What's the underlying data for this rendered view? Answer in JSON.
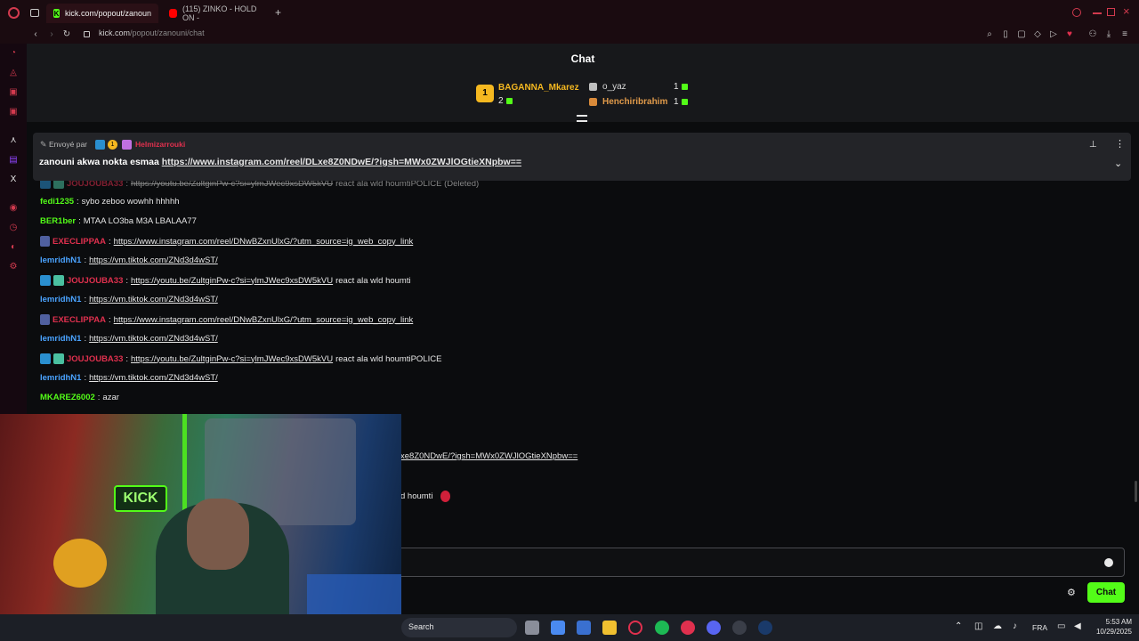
{
  "browser": {
    "tabs": [
      {
        "label": "kick.com/popout/zanoun"
      },
      {
        "label": "(115) ZINKO - HOLD ON -"
      }
    ],
    "url_host": "kick.com",
    "url_path": "/popout/zanouni/chat"
  },
  "chat": {
    "title": "Chat",
    "leaderboard": [
      {
        "rank": "1",
        "name": "BAGANNA_Mkarez",
        "count": "2"
      },
      {
        "rank": "2",
        "name": "o_yaz",
        "count": "1"
      },
      {
        "rank": "3",
        "name": "Henchiribrahim",
        "count": "1"
      }
    ],
    "pinned": {
      "sent_by": "Envoyé par",
      "badge_num": "1",
      "sender": "Helmizarrouki",
      "text": "zanouni akwa nokta esmaa",
      "link": "https://www.instagram.com/reel/DLxe8Z0NDwE/?igsh=MWx0ZWJlOGtieXNpbw=="
    },
    "messages": [
      {
        "user": "JOUJOUBA33",
        "color": "#e0304e",
        "text": "",
        "link": "https://youtu.be/ZultginPw-c?si=ylmJWec9xsDW5kVU",
        "after": "react ala wld houmtiPOLICE (Deleted)",
        "deleted": true
      },
      {
        "user": "fedi1235",
        "color": "#53fc18",
        "text": "sybo zeboo wowhh hhhhh",
        "link": "",
        "after": ""
      },
      {
        "user": "BER1ber",
        "color": "#53fc18",
        "text": "MTAA LO3ba M3A LBALAA77",
        "link": "",
        "after": ""
      },
      {
        "user": "EXECLIPPAA",
        "color": "#e0304e",
        "text": "",
        "link": "https://www.instagram.com/reel/DNwBZxnUlxG/?utm_source=ig_web_copy_link",
        "after": ""
      },
      {
        "user": "lemridhN1",
        "color": "#4aa3ff",
        "text": "",
        "link": "https://vm.tiktok.com/ZNd3d4wST/",
        "after": ""
      },
      {
        "user": "JOUJOUBA33",
        "color": "#e0304e",
        "text": "",
        "link": "https://youtu.be/ZultginPw-c?si=ylmJWec9xsDW5kVU",
        "after": "react ala wld houmti"
      },
      {
        "user": "lemridhN1",
        "color": "#4aa3ff",
        "text": "",
        "link": "https://vm.tiktok.com/ZNd3d4wST/",
        "after": ""
      },
      {
        "user": "EXECLIPPAA",
        "color": "#e0304e",
        "text": "",
        "link": "https://www.instagram.com/reel/DNwBZxnUlxG/?utm_source=ig_web_copy_link",
        "after": ""
      },
      {
        "user": "lemridhN1",
        "color": "#4aa3ff",
        "text": "",
        "link": "https://vm.tiktok.com/ZNd3d4wST/",
        "after": ""
      },
      {
        "user": "JOUJOUBA33",
        "color": "#e0304e",
        "text": "",
        "link": "https://youtu.be/ZultginPw-c?si=ylmJWec9xsDW5kVU",
        "after": "react ala wld houmtiPOLICE"
      },
      {
        "user": "lemridhN1",
        "color": "#4aa3ff",
        "text": "",
        "link": "https://vm.tiktok.com/ZNd3d4wST/",
        "after": ""
      },
      {
        "user": "MKAREZ6002",
        "color": "#53fc18",
        "text": "azar",
        "link": "",
        "after": ""
      }
    ],
    "partial_link": "xe8Z0NDwE/?igsh=MWx0ZWJlOGtieXNpbw==",
    "partial_text": "d houmti",
    "send_label": "Chat"
  },
  "webcam": {
    "sign": "KICK"
  },
  "taskbar": {
    "search": "Search",
    "lang": "FRA",
    "time": "5:53 AM",
    "date": "10/29/2025"
  },
  "colors": {
    "kick_green": "#53fc18",
    "accent_red": "#e0304e",
    "link_blue": "#4aa3ff"
  }
}
